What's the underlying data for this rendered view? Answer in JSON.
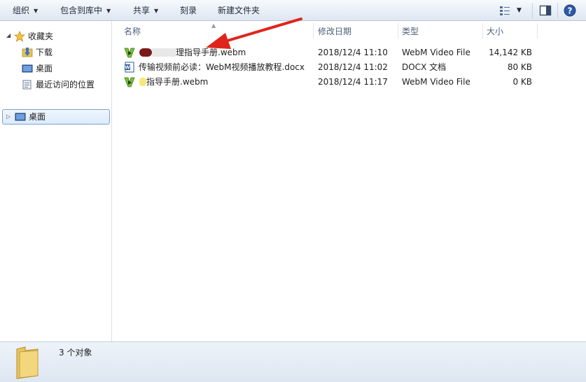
{
  "toolbar": {
    "organize": "组织",
    "include_library": "包含到库中",
    "share": "共享",
    "burn": "刻录",
    "new_folder": "新建文件夹"
  },
  "nav": {
    "favorites": "收藏夹",
    "downloads": "下载",
    "desktop": "桌面",
    "recent": "最近访问的位置",
    "desktop_tree": "桌面"
  },
  "columns": {
    "name": "名称",
    "modified": "修改日期",
    "type": "类型",
    "size": "大小"
  },
  "files": [
    {
      "name": "理指导手册.webm",
      "modified": "2018/12/4 11:10",
      "type": "WebM Video File",
      "size": "14,142 KB",
      "icon": "webm-file-icon"
    },
    {
      "name": "传输视频前必读：WebM视频播放教程.docx",
      "modified": "2018/12/4 11:02",
      "type": "DOCX 文档",
      "size": "80 KB",
      "icon": "word-document-icon"
    },
    {
      "name": "指导手册.webm",
      "modified": "2018/12/4 11:17",
      "type": "WebM Video File",
      "size": "0 KB",
      "icon": "webm-file-icon"
    }
  ],
  "status": {
    "count": "3 个对象"
  },
  "colors": {
    "accent_arrow": "#e0241c",
    "selection_border": "#7da2ce",
    "header_text": "#4c607a"
  }
}
